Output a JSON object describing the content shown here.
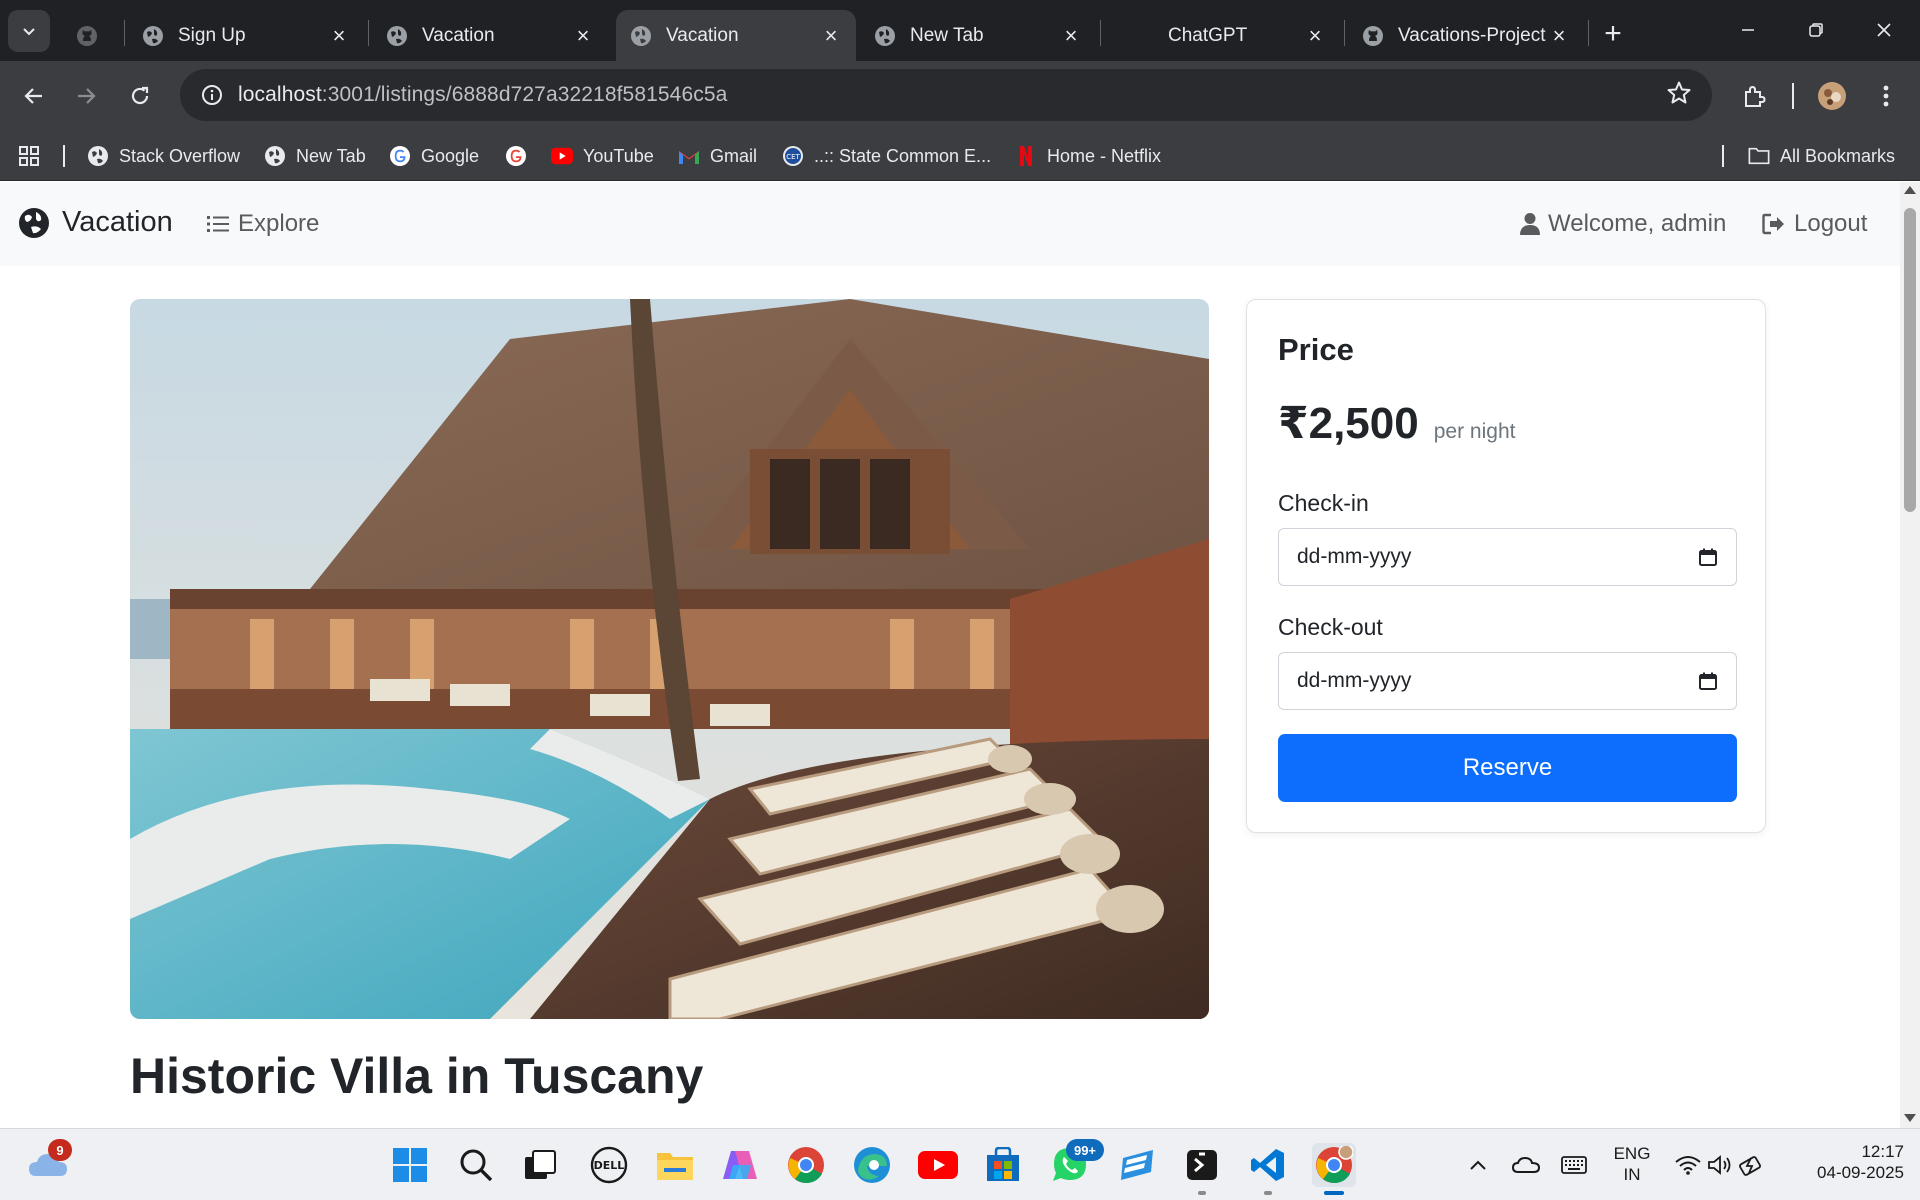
{
  "browser": {
    "tabs": [
      {
        "label": "",
        "favicon": "github-icon"
      },
      {
        "label": "Sign Up",
        "favicon": "globe-icon"
      },
      {
        "label": "Vacation",
        "favicon": "globe-icon"
      },
      {
        "label": "Vacation",
        "favicon": "globe-icon",
        "active": true
      },
      {
        "label": "New Tab",
        "favicon": "globe-icon"
      },
      {
        "label": "ChatGPT",
        "favicon": "none"
      },
      {
        "label": "Vacations-Project",
        "favicon": "github-icon"
      }
    ],
    "url_host": "localhost",
    "url_rest": ":3001/listings/6888d727a32218f581546c5a",
    "bookmarks": [
      {
        "label": "Stack Overflow",
        "icon": "globe-icon"
      },
      {
        "label": "New Tab",
        "icon": "globe-icon"
      },
      {
        "label": "Google",
        "icon": "google-icon"
      },
      {
        "label": "",
        "icon": "google-icon"
      },
      {
        "label": "YouTube",
        "icon": "youtube-icon"
      },
      {
        "label": "Gmail",
        "icon": "gmail-icon"
      },
      {
        "label": "..:: State Common E...",
        "icon": "cet-icon"
      },
      {
        "label": "Home - Netflix",
        "icon": "netflix-icon"
      }
    ],
    "all_bookmarks": "All Bookmarks"
  },
  "navbar": {
    "brand": "Vacation",
    "explore": "Explore",
    "welcome": "Welcome, admin",
    "logout": "Logout"
  },
  "listing": {
    "title": "Historic Villa in Tuscany",
    "image_alt": "Resort pool deck with lounge chairs and wooden lodge"
  },
  "booking": {
    "heading": "Price",
    "price": "₹2,500",
    "unit": "per night",
    "checkin_label": "Check-in",
    "checkin_placeholder": "dd-mm-yyyy",
    "checkout_label": "Check-out",
    "checkout_placeholder": "dd-mm-yyyy",
    "reserve": "Reserve"
  },
  "taskbar": {
    "weather_badge": "9",
    "whatsapp_badge": "99+",
    "lang_top": "ENG",
    "lang_bottom": "IN",
    "time": "12:17",
    "date": "04-09-2025"
  },
  "colors": {
    "primary": "#0d6efd",
    "chrome_dark": "#202124",
    "chrome_toolbar": "#3c3d40",
    "navbar_bg": "#f8f9fa"
  }
}
